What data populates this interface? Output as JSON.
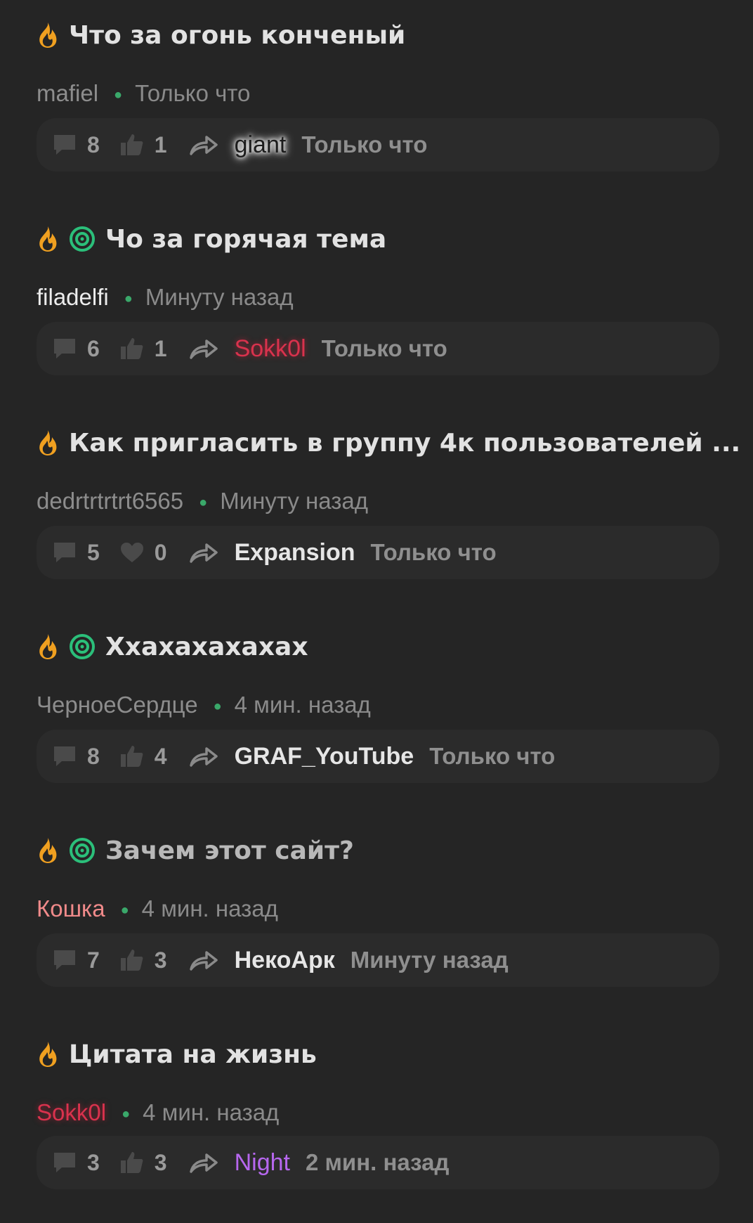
{
  "colors": {
    "background": "#252525",
    "fire": "#f0a020",
    "target": "#2bbf7a",
    "online_dot": "#3aa86a",
    "accent_red": "#d9324d",
    "accent_pink": "#f08a8a",
    "accent_purple": "#b667ee"
  },
  "topics": [
    {
      "title": "Что за огонь конченый",
      "icons": [
        "fire-icon"
      ],
      "author": "mafiel",
      "time": "Только что",
      "comments": "8",
      "reaction_icon": "like-icon",
      "reactions": "1",
      "last_user": "giant",
      "last_time": "Только что"
    },
    {
      "title": "Чо за горячая тема",
      "icons": [
        "fire-icon",
        "target-icon"
      ],
      "author": "filadelfi",
      "time": "Минуту назад",
      "comments": "6",
      "reaction_icon": "like-icon",
      "reactions": "1",
      "last_user": "Sokk0l",
      "last_time": "Только что"
    },
    {
      "title": "Как пригласить в группу 4к пользователей ...",
      "icons": [
        "fire-icon"
      ],
      "author": "dedrtrtrtrt6565",
      "time": "Минуту назад",
      "comments": "5",
      "reaction_icon": "heart-icon",
      "reactions": "0",
      "last_user": "Expansion",
      "last_time": "Только что"
    },
    {
      "title": "Ххахахахахах",
      "icons": [
        "fire-icon",
        "target-icon"
      ],
      "author": "ЧерноеСердце",
      "time": "4 мин. назад",
      "comments": "8",
      "reaction_icon": "like-icon",
      "reactions": "4",
      "last_user": "GRAF_YouTube",
      "last_time": "Только что"
    },
    {
      "title": "Зачем этот сайт?",
      "icons": [
        "fire-icon",
        "target-icon"
      ],
      "author": "Кошка",
      "time": "4 мин. назад",
      "comments": "7",
      "reaction_icon": "like-icon",
      "reactions": "3",
      "last_user": "НекоАрк",
      "last_time": "Минуту назад"
    },
    {
      "title": "Цитата на жизнь",
      "icons": [
        "fire-icon"
      ],
      "author": "Sokk0l",
      "time": "4 мин. назад",
      "comments": "3",
      "reaction_icon": "like-icon",
      "reactions": "3",
      "last_user": "Night",
      "last_time": "2 мин. назад"
    }
  ]
}
